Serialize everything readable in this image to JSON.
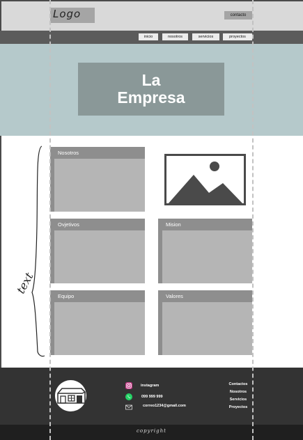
{
  "header": {
    "logo_text": "Logo",
    "contact_label": "contacto"
  },
  "nav": {
    "items": [
      {
        "label": "inicio"
      },
      {
        "label": "nosotros"
      },
      {
        "label": "servicios"
      },
      {
        "label": "proyectos"
      }
    ]
  },
  "hero": {
    "title_line1": "La",
    "title_line2": "Empresa"
  },
  "sections": {
    "nosotros": "Nosotros",
    "objetivos": "Ovjetivos",
    "mision": "Mision",
    "equipo": "Equipo",
    "valores": "Valores"
  },
  "annotation": {
    "side_note": "text"
  },
  "footer": {
    "social": [
      {
        "icon": "instagram-icon",
        "text": "instagram"
      },
      {
        "icon": "whatsapp-icon",
        "text": "099 999 999"
      },
      {
        "icon": "email-icon",
        "text": "correo1234@gmail.com"
      }
    ],
    "links": [
      "Contactos",
      "Nosotros",
      "Servicios",
      "Proyectos"
    ],
    "copyright": "copyright"
  },
  "colors": {
    "header_bg": "#d9d9d9",
    "nav_bg": "#5b5b5b",
    "hero_bg": "#b5c9cb",
    "hero_box": "#8a9898",
    "card_bg": "#b5b5b5",
    "card_head": "#8e8e8e",
    "footer_bg": "#333333"
  }
}
